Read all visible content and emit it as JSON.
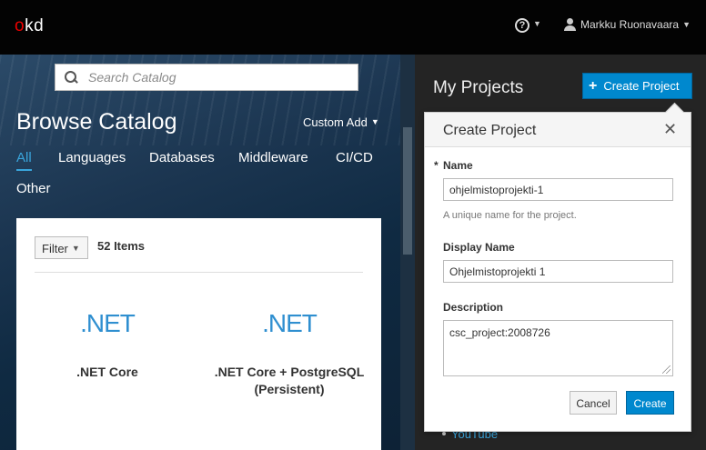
{
  "navbar": {
    "logo": "okd",
    "help_icon": "question-circle-icon",
    "user_name": "Markku Ruonavaara"
  },
  "catalog": {
    "search_placeholder": "Search Catalog",
    "title": "Browse Catalog",
    "custom_add": "Custom Add",
    "tabs": [
      "All",
      "Languages",
      "Databases",
      "Middleware",
      "CI/CD",
      "Other"
    ],
    "active_tab": "All",
    "filter_label": "Filter",
    "items_count": "52 Items",
    "tiles": [
      {
        "logo": ".NET",
        "name": ".NET Core"
      },
      {
        "logo": ".NET",
        "name": ".NET Core + PostgreSQL (Persistent)"
      }
    ]
  },
  "projects": {
    "title": "My Projects",
    "create_button": "Create Project",
    "link_partial": "YouTube"
  },
  "popover": {
    "title": "Create Project",
    "name_label": "Name",
    "name_value": "ohjelmistoprojekti-1",
    "name_help": "A unique name for the project.",
    "display_name_label": "Display Name",
    "display_name_value": "Ohjelmistoprojekti 1",
    "description_label": "Description",
    "description_value": "csc_project:2008726",
    "cancel_label": "Cancel",
    "create_label": "Create"
  },
  "colors": {
    "accent": "#0088ce",
    "link": "#39a5dc",
    "navbar": "#030303"
  }
}
